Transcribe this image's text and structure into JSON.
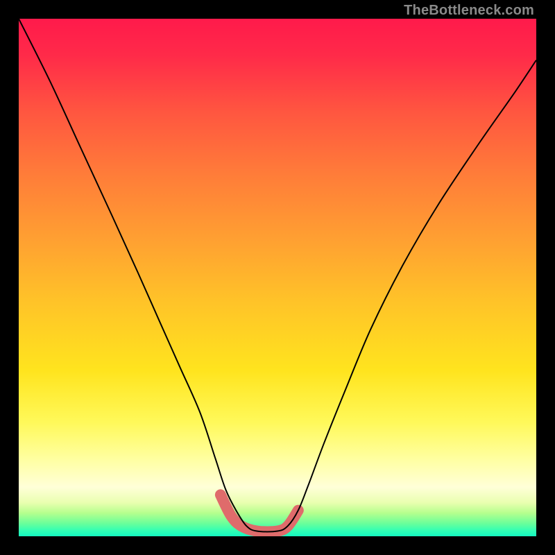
{
  "watermark": "TheBottleneck.com",
  "gradient_stops": [
    {
      "offset": 0.0,
      "color": "#ff1a4b"
    },
    {
      "offset": 0.07,
      "color": "#ff2a49"
    },
    {
      "offset": 0.18,
      "color": "#ff5640"
    },
    {
      "offset": 0.3,
      "color": "#ff7c39"
    },
    {
      "offset": 0.42,
      "color": "#ff9e32"
    },
    {
      "offset": 0.55,
      "color": "#ffc428"
    },
    {
      "offset": 0.68,
      "color": "#ffe41e"
    },
    {
      "offset": 0.78,
      "color": "#fff95a"
    },
    {
      "offset": 0.85,
      "color": "#ffffa0"
    },
    {
      "offset": 0.905,
      "color": "#ffffd8"
    },
    {
      "offset": 0.935,
      "color": "#e9ffb0"
    },
    {
      "offset": 0.955,
      "color": "#b6ff8e"
    },
    {
      "offset": 0.975,
      "color": "#6bff9a"
    },
    {
      "offset": 0.99,
      "color": "#2effb6"
    },
    {
      "offset": 1.0,
      "color": "#14f7c0"
    }
  ],
  "chart_data": {
    "type": "line",
    "title": "",
    "xlabel": "",
    "ylabel": "",
    "xlim": [
      0,
      100
    ],
    "ylim": [
      0,
      100
    ],
    "series": [
      {
        "name": "bottleneck-curve",
        "x": [
          0,
          6,
          12,
          18,
          23,
          27,
          31,
          35,
          38,
          40,
          42,
          44,
          46,
          50,
          52,
          54,
          56,
          59,
          63,
          68,
          74,
          81,
          89,
          96,
          100
        ],
        "y": [
          100,
          88,
          75,
          62,
          51,
          42,
          33,
          24,
          15,
          9,
          5,
          2,
          1,
          1,
          2,
          5,
          10,
          18,
          28,
          40,
          52,
          64,
          76,
          86,
          92
        ]
      },
      {
        "name": "optimal-band",
        "x": [
          39,
          41,
          43,
          46,
          50,
          52,
          54
        ],
        "y": [
          8,
          4,
          2,
          1,
          1,
          2,
          5
        ]
      }
    ],
    "annotations": []
  },
  "styles": {
    "curve_color": "#000000",
    "curve_width": 2,
    "band_color": "#df6b6b",
    "band_width": 16
  }
}
